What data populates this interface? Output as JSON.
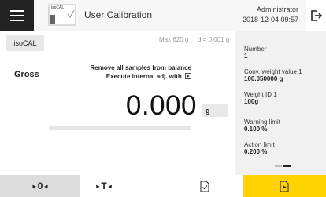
{
  "header": {
    "app_icon_label": "isoCAL",
    "title": "User Calibration",
    "user": "Administrator",
    "datetime": "2018-12-04   09:57"
  },
  "left": {
    "mode_button": "isoCAL",
    "max_capacity": "Max 620 g",
    "readability": "d = 0.001 g",
    "gross_label": "Gross",
    "message_line1": "Remove all samples from balance",
    "message_line2": "Execute internal adj. with",
    "weight_value": "0.000",
    "unit": "g"
  },
  "right": {
    "items": [
      {
        "label": "Number",
        "value": "1"
      },
      {
        "label": "Conv. weight value 1",
        "value": "100.050000 g"
      },
      {
        "label": "Weight ID 1",
        "value": "100g"
      },
      {
        "label": "Warning limit",
        "value": "0.100 %"
      },
      {
        "label": "Action limit",
        "value": "0.200 %"
      }
    ]
  },
  "footer": {
    "zero_label": "0",
    "tare_label": "T"
  },
  "colors": {
    "accent": "#ffd200",
    "dark": "#222222"
  }
}
